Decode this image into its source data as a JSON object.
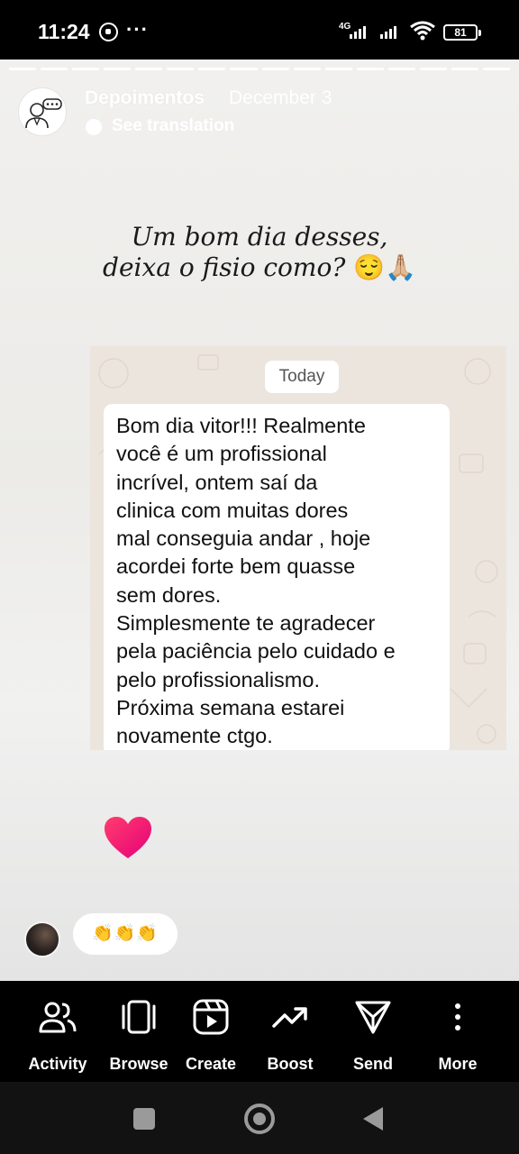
{
  "status_bar": {
    "time": "11:24",
    "network": "4G",
    "battery": "81",
    "icons": [
      "whatsapp-icon",
      "more-dots-icon",
      "signal-icon",
      "wifi-icon",
      "battery-icon"
    ]
  },
  "story": {
    "account_name": "Depoimentos",
    "date": "December 3",
    "translation_label": "See translation",
    "caption_line1": "Um bom dia desses,",
    "caption_line2": "deixa o fisio como? ",
    "caption_emoji": "😌🙏🏼",
    "chat": {
      "date_chip": "Today",
      "message": "Bom dia vitor!!! Realmente\nvocê é um profissional\nincrível,  ontem saí da\nclinica com muitas dores\nmal conseguia andar , hoje\nacordei forte bem quasse\nsem dores.\nSimplesmente te agradecer\npela paciência pelo cuidado e\npelo profissionalismo.\nPróxima semana estarei\nnovamente ctgo."
    },
    "reaction": "👏👏👏"
  },
  "actions": [
    {
      "label": "Activity",
      "icon": "activity-icon"
    },
    {
      "label": "Browse",
      "icon": "browse-icon"
    },
    {
      "label": "Create",
      "icon": "create-icon"
    },
    {
      "label": "Boost",
      "icon": "boost-icon"
    },
    {
      "label": "Send",
      "icon": "send-icon"
    },
    {
      "label": "More",
      "icon": "more-icon"
    }
  ],
  "colors": {
    "heart": "#ff1f6b",
    "background": "#000000",
    "story_bg": "#eeedeb"
  }
}
